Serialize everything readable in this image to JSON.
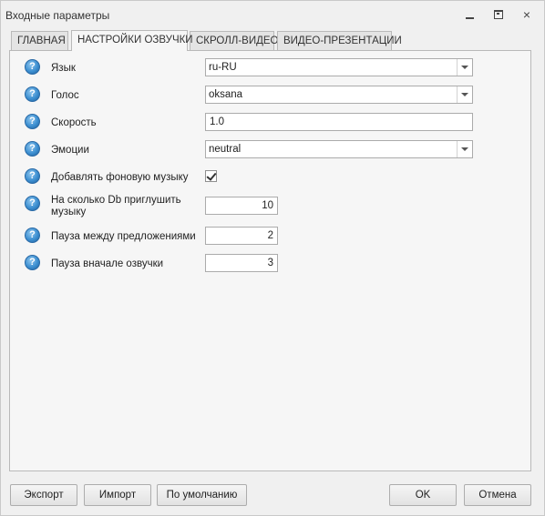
{
  "window": {
    "title": "Входные параметры",
    "close_glyph": "×"
  },
  "tabs": [
    {
      "label": "ГЛАВНАЯ",
      "active": false
    },
    {
      "label": "НАСТРОЙКИ ОЗВУЧКИ",
      "active": true
    },
    {
      "label": "СКРОЛЛ-ВИДЕО",
      "active": false
    },
    {
      "label": "ВИДЕО-ПРЕЗЕНТАЦИИ",
      "active": false
    }
  ],
  "form": {
    "language": {
      "label": "Язык",
      "value": "ru-RU"
    },
    "voice": {
      "label": "Голос",
      "value": "oksana"
    },
    "speed": {
      "label": "Скорость",
      "value": "1.0"
    },
    "emotion": {
      "label": "Эмоции",
      "value": "neutral"
    },
    "background_music": {
      "label": "Добавлять фоновую музыку",
      "checked": true
    },
    "music_db": {
      "label": "На сколько Db приглушить музыку",
      "value": "10"
    },
    "pause_sentences": {
      "label": "Пауза между предложениями",
      "value": "2"
    },
    "pause_start": {
      "label": "Пауза вначале озвучки",
      "value": "3"
    },
    "help_glyph": "?"
  },
  "footer": {
    "export_label": "Экспорт",
    "import_label": "Импорт",
    "default_label": "По умолчанию",
    "ok_label": "OK",
    "cancel_label": "Отмена"
  },
  "colors": {
    "help_icon": "#3c8fd1",
    "window_bg": "#f0f0f0"
  }
}
